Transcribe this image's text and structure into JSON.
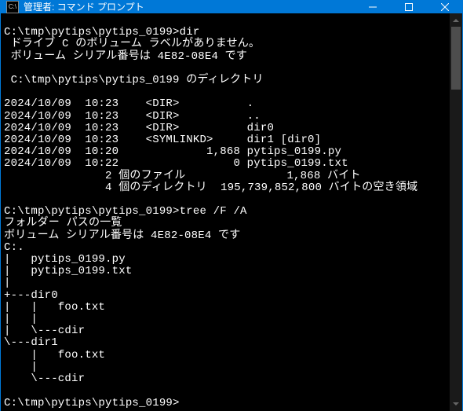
{
  "titlebar": {
    "icon_label": "C:\\",
    "title": "管理者: コマンド プロンプト"
  },
  "terminal": {
    "lines": [
      "",
      "C:\\tmp\\pytips\\pytips_0199>dir",
      " ドライブ C のボリューム ラベルがありません。",
      " ボリューム シリアル番号は 4E82-08E4 です",
      "",
      " C:\\tmp\\pytips\\pytips_0199 のディレクトリ",
      "",
      "2024/10/09  10:23    <DIR>          .",
      "2024/10/09  10:23    <DIR>          ..",
      "2024/10/09  10:23    <DIR>          dir0",
      "2024/10/09  10:23    <SYMLINKD>     dir1 [dir0]",
      "2024/10/09  10:20             1,868 pytips_0199.py",
      "2024/10/09  10:22                 0 pytips_0199.txt",
      "               2 個のファイル               1,868 バイト",
      "               4 個のディレクトリ  195,739,852,800 バイトの空き領域",
      "",
      "C:\\tmp\\pytips\\pytips_0199>tree /F /A",
      "フォルダー パスの一覧",
      "ボリューム シリアル番号は 4E82-08E4 です",
      "C:.",
      "|   pytips_0199.py",
      "|   pytips_0199.txt",
      "|",
      "+---dir0",
      "|   |   foo.txt",
      "|   |",
      "|   \\---cdir",
      "\\---dir1",
      "    |   foo.txt",
      "    |",
      "    \\---cdir",
      "",
      "C:\\tmp\\pytips\\pytips_0199>"
    ]
  }
}
